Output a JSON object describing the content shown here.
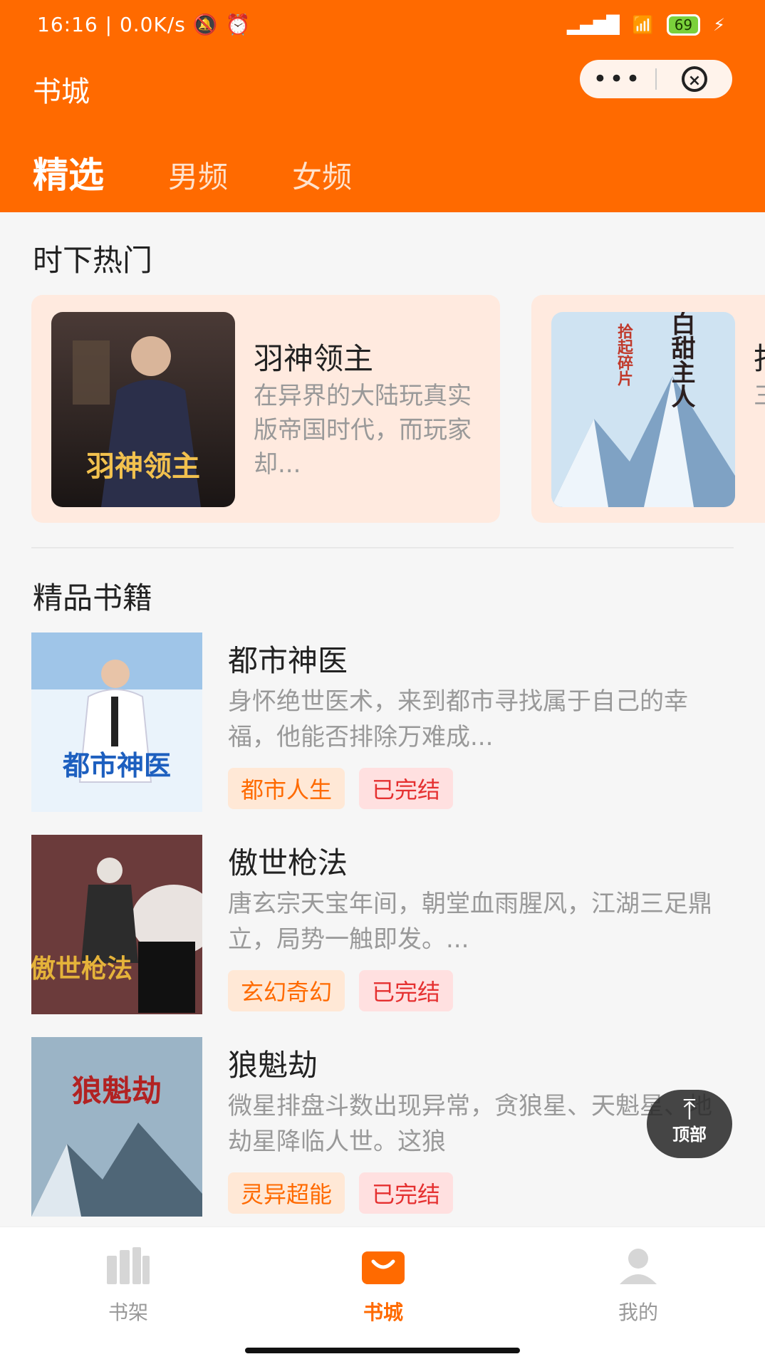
{
  "status_bar": {
    "time": "16:16",
    "net_speed": "0.0K/s",
    "battery": "69"
  },
  "header": {
    "title": "书城",
    "tabs": [
      {
        "label": "精选"
      },
      {
        "label": "男频"
      },
      {
        "label": "女频"
      }
    ]
  },
  "hot": {
    "title": "时下热门",
    "items": [
      {
        "name": "羽神领主",
        "desc": "在异界的大陆玩真实版帝国时代，而玩家却...",
        "cover_text": "羽神领主"
      },
      {
        "name": "抖",
        "desc": "三被孩",
        "cover_text": "傻白甜主人",
        "cover_sub": "拾起碎片"
      }
    ]
  },
  "premium": {
    "title": "精品书籍",
    "books": [
      {
        "name": "都市神医",
        "desc": "身怀绝世医术，来到都市寻找属于自己的幸福，他能否排除万难成...",
        "genre": "都市人生",
        "status": "已完结",
        "cover_text": "都市神医"
      },
      {
        "name": "傲世枪法",
        "desc": "唐玄宗天宝年间，朝堂血雨腥风，江湖三足鼎立，局势一触即发。...",
        "genre": "玄幻奇幻",
        "status": "已完结",
        "cover_text": "傲世枪法"
      },
      {
        "name": "狼魁劫",
        "desc": "微星排盘斗数出现异常，贪狼星、天魁星、地劫星降临人世。这狼",
        "genre": "灵异超能",
        "status": "已完结",
        "cover_text": "狼魁劫"
      }
    ]
  },
  "back_to_top": {
    "label": "顶部"
  },
  "tabbar": {
    "items": [
      {
        "label": "书架",
        "icon": "bookshelf-icon"
      },
      {
        "label": "书城",
        "icon": "store-bag-icon"
      },
      {
        "label": "我的",
        "icon": "user-icon"
      }
    ]
  },
  "colors": {
    "brand": "#ff6a00",
    "tag_genre_bg": "#ffe8d6",
    "tag_done_text": "#e53030"
  }
}
